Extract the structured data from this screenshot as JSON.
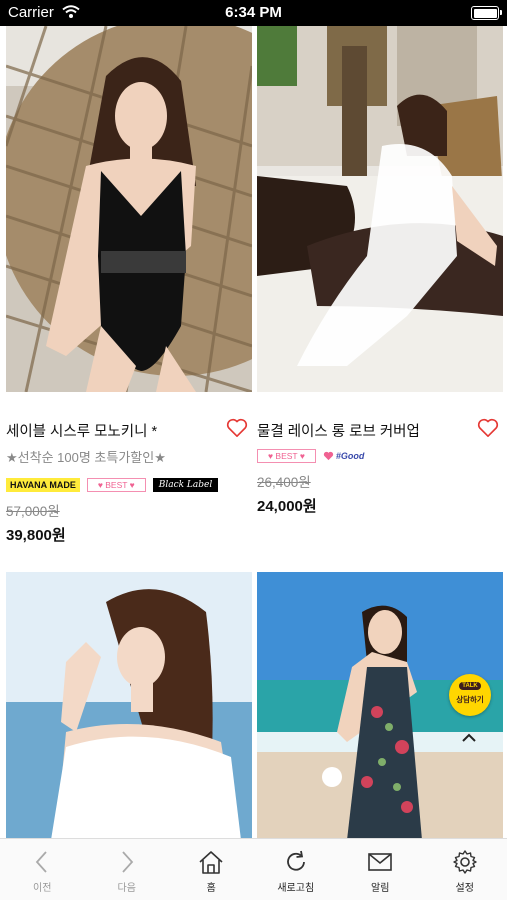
{
  "status_bar": {
    "carrier": "Carrier",
    "time": "6:34 PM"
  },
  "products": [
    {
      "name": "세이블 시스루 모노키니 *",
      "subtitle": "★선착순 100명 초특가할인★",
      "badges": [
        "HAVANA MADE",
        "♥ BEST ♥",
        "Black Label"
      ],
      "original_price": "57,000원",
      "sale_price": "39,800원",
      "wishlisted": false
    },
    {
      "name": "물결 레이스 롱 로브 커버업",
      "badges": [
        "♥ BEST ♥",
        "#Good"
      ],
      "original_price": "26,400원",
      "sale_price": "24,000원",
      "wishlisted": false
    },
    {
      "name": ""
    },
    {
      "name": ""
    }
  ],
  "floating": {
    "kakao_tag": "TALK",
    "kakao_label": "상담하기"
  },
  "tab_bar": [
    {
      "label": "이전",
      "icon": "chevron-left-icon",
      "enabled": false
    },
    {
      "label": "다음",
      "icon": "chevron-right-icon",
      "enabled": false
    },
    {
      "label": "홈",
      "icon": "home-icon",
      "enabled": true
    },
    {
      "label": "새로고침",
      "icon": "refresh-icon",
      "enabled": true
    },
    {
      "label": "알림",
      "icon": "mail-icon",
      "enabled": true
    },
    {
      "label": "설정",
      "icon": "gear-icon",
      "enabled": true
    }
  ],
  "colors": {
    "heart": "#e53935",
    "badge_yellow": "#ffeb3b",
    "badge_pink": "#f06292",
    "kakao": "#ffd600"
  }
}
